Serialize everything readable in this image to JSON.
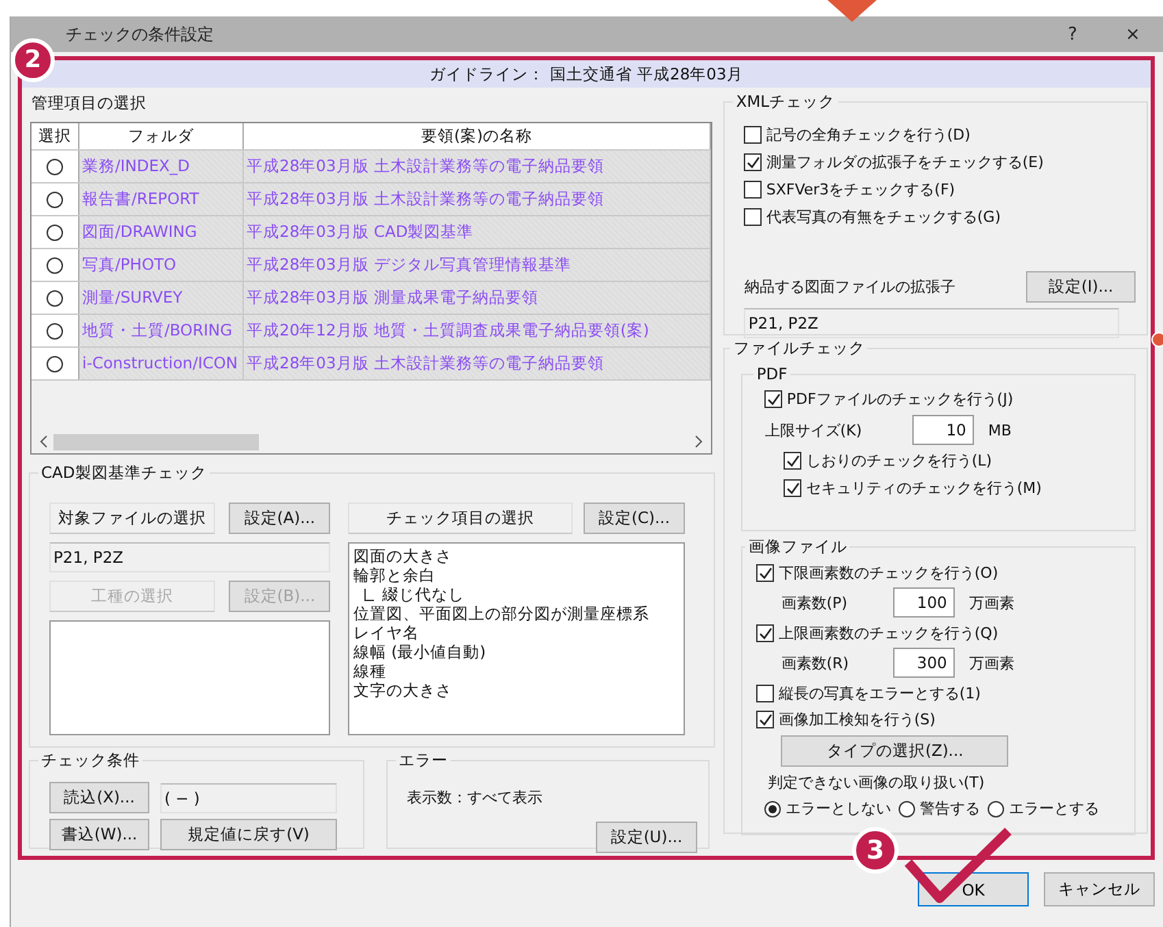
{
  "window": {
    "title": "チェックの条件設定",
    "help": "?",
    "close": "×"
  },
  "guideline": "ガイドライン： 国土交通省 平成28年03月",
  "management": {
    "title": "管理項目の選択",
    "columns": [
      "選択",
      "フォルダ",
      "要領(案)の名称"
    ],
    "rows": [
      {
        "selected": false,
        "folder": "業務/INDEX_D",
        "name": "平成28年03月版 土木設計業務等の電子納品要領"
      },
      {
        "selected": false,
        "folder": "報告書/REPORT",
        "name": "平成28年03月版 土木設計業務等の電子納品要領"
      },
      {
        "selected": false,
        "folder": "図面/DRAWING",
        "name": "平成28年03月版 CAD製図基準"
      },
      {
        "selected": false,
        "folder": "写真/PHOTO",
        "name": "平成28年03月版 デジタル写真管理情報基準"
      },
      {
        "selected": false,
        "folder": "測量/SURVEY",
        "name": "平成28年03月版 測量成果電子納品要領"
      },
      {
        "selected": false,
        "folder": "地質・土質/BORING",
        "name": "平成20年12月版 地質・土質調査成果電子納品要領(案)"
      },
      {
        "selected": false,
        "folder": "i-Construction/ICON",
        "name": "平成28年03月版 土木設計業務等の電子納品要領"
      }
    ]
  },
  "cad": {
    "title": "CAD製図基準チェック",
    "target_label": "対象ファイルの選択",
    "target_button": "設定(A)...",
    "target_value": "P21, P2Z",
    "work_label": "工種の選択",
    "work_button": "設定(B)...",
    "work_disabled": true,
    "items_label": "チェック項目の選択",
    "items_button": "設定(C)...",
    "items": [
      {
        "text": "図面の大きさ"
      },
      {
        "text": "輪郭と余白",
        "children": [
          {
            "text": "綴じ代なし"
          }
        ]
      },
      {
        "text": "位置図、平面図上の部分図が測量座標系"
      },
      {
        "text": "レイヤ名"
      },
      {
        "text": "線幅 (最小値自動)"
      },
      {
        "text": "線種"
      },
      {
        "text": "文字の大きさ"
      }
    ]
  },
  "conditions": {
    "title": "チェック条件",
    "read_button": "読込(X)...",
    "value": "( − )",
    "write_button": "書込(W)...",
    "reset_button": "規定値に戻す(V)"
  },
  "error": {
    "title": "エラー",
    "display": "表示数：すべて表示",
    "button": "設定(U)..."
  },
  "xml": {
    "title": "XMLチェック",
    "options": [
      {
        "label": "記号の全角チェックを行う(D)",
        "checked": false
      },
      {
        "label": "測量フォルダの拡張子をチェックする(E)",
        "checked": true
      },
      {
        "label": "SXFVer3をチェックする(F)",
        "checked": false
      },
      {
        "label": "代表写真の有無をチェックする(G)",
        "checked": false
      }
    ],
    "ext_label": "納品する図面ファイルの拡張子",
    "ext_button": "設定(I)...",
    "ext_value": "P21, P2Z"
  },
  "file_check": {
    "title": "ファイルチェック",
    "pdf": {
      "title": "PDF",
      "enable": {
        "label": "PDFファイルのチェックを行う(J)",
        "checked": true
      },
      "size_label": "上限サイズ(K)",
      "size_value": "10",
      "size_unit": "MB",
      "options": [
        {
          "label": "しおりのチェックを行う(L)",
          "checked": true
        },
        {
          "label": "セキュリティのチェックを行う(M)",
          "checked": true
        }
      ]
    },
    "image": {
      "title": "画像ファイル",
      "limits": [
        {
          "label": "下限画素数のチェックを行う(O)",
          "checked": true,
          "count_label": "画素数(P)",
          "value": "100",
          "unit": "万画素"
        },
        {
          "label": "上限画素数のチェックを行う(Q)",
          "checked": true,
          "count_label": "画素数(R)",
          "value": "300",
          "unit": "万画素"
        }
      ],
      "options": [
        {
          "label": "縦長の写真をエラーとする(1)",
          "checked": false
        },
        {
          "label": "画像加工検知を行う(S)",
          "checked": true
        }
      ],
      "type_button": "タイプの選択(Z)...",
      "handling_label": "判定できない画像の取り扱い(T)",
      "handling": [
        {
          "label": "エラーとしない",
          "selected": true
        },
        {
          "label": "警告する",
          "selected": false
        },
        {
          "label": "エラーとする",
          "selected": false
        }
      ]
    }
  },
  "footer": {
    "ok": "OK",
    "cancel": "キャンセル"
  },
  "annotations": [
    {
      "label": "2"
    },
    {
      "label": "3"
    }
  ]
}
